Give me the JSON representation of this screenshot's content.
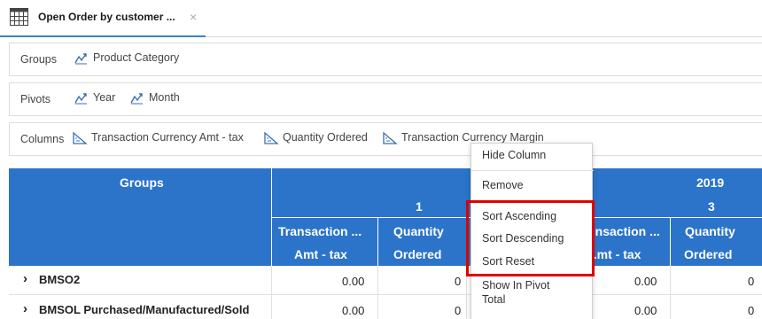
{
  "tab": {
    "title": "Open Order by customer ...",
    "close": "×"
  },
  "config": {
    "groups": {
      "label": "Groups",
      "items": [
        "Product Category"
      ]
    },
    "pivots": {
      "label": "Pivots",
      "items": [
        "Year",
        "Month"
      ]
    },
    "columns": {
      "label": "Columns",
      "items": [
        "Transaction Currency Amt - tax",
        "Quantity Ordered",
        "Transaction Currency Margin"
      ]
    }
  },
  "table": {
    "groups_header": "Groups",
    "year": "2019",
    "months": [
      "1",
      "3"
    ],
    "col_headers": [
      {
        "line1": "Transaction ...",
        "line2": "Amt - tax"
      },
      {
        "line1": "Quantity",
        "line2": "Ordered"
      },
      {
        "line1": "...nsaction ...",
        "line2": "...mt - tax"
      },
      {
        "line1": "Quantity",
        "line2": "Ordered"
      }
    ],
    "rows": [
      {
        "expander": "›",
        "label": "BMSO2",
        "values": [
          "0.00",
          "0",
          "0.00",
          "0"
        ]
      },
      {
        "expander": "›",
        "label": "BMSOL Purchased/Manufactured/Sold",
        "values": [
          "0.00",
          "0",
          "0.00",
          "0"
        ]
      }
    ]
  },
  "context_menu": {
    "items": [
      "Hide Column",
      "Remove",
      "Sort Ascending",
      "Sort Descending",
      "Sort Reset",
      "Show In Pivot Total"
    ]
  },
  "colors": {
    "header_bg": "#2b74c9",
    "tab_accent": "#3b82c4",
    "highlight": "#e00000"
  }
}
